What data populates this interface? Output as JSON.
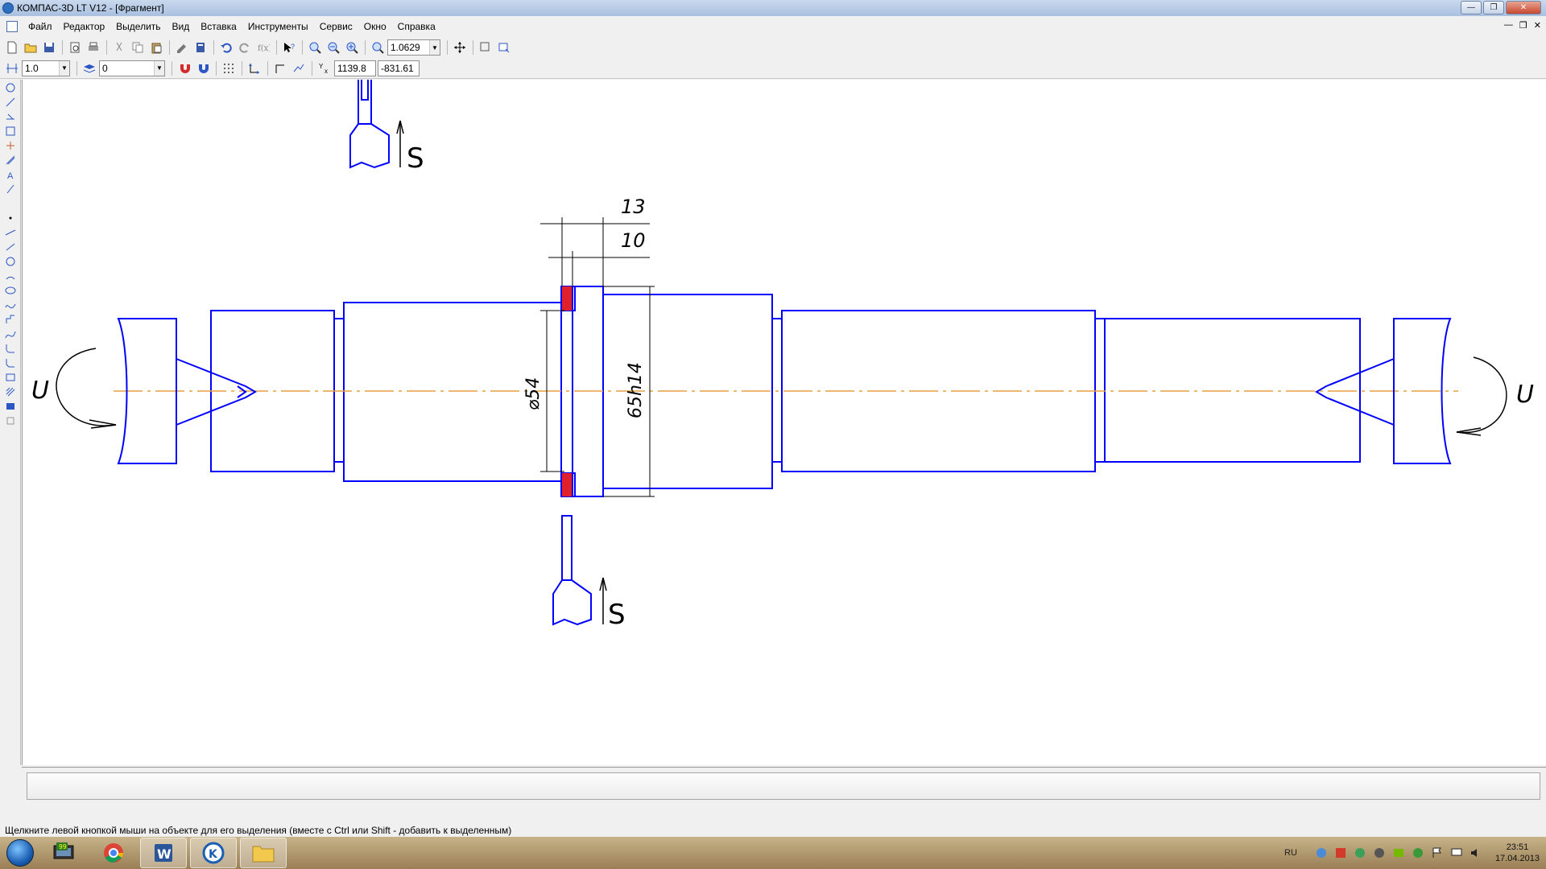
{
  "window": {
    "title": "КОМПАС-3D LT V12 - [Фрагмент]"
  },
  "menu": {
    "items": [
      "Файл",
      "Редактор",
      "Выделить",
      "Вид",
      "Вставка",
      "Инструменты",
      "Сервис",
      "Окно",
      "Справка"
    ]
  },
  "toolbar": {
    "zoom_value": "1.0629",
    "step_value": "1.0",
    "layer_value": "0",
    "coord_x": "1139.8",
    "coord_y": "-831.61"
  },
  "drawing": {
    "dim_13": "13",
    "dim_10": "10",
    "dim_diameter": "⌀54",
    "dim_fit": "65h14",
    "label_s_top": "S",
    "label_s_bottom": "S",
    "label_u_left": "U",
    "label_u_right": "U",
    "line_color": "#0000ff",
    "axis_color": "#e6a040",
    "hatch_color": "#e0202a"
  },
  "status": {
    "hint": "Щелкните левой кнопкой мыши на объекте для его выделения (вместе с Ctrl или Shift - добавить к выделенным)"
  },
  "taskbar": {
    "lang": "RU",
    "time": "23:51",
    "date": "17.04.2013",
    "badge": "99"
  }
}
